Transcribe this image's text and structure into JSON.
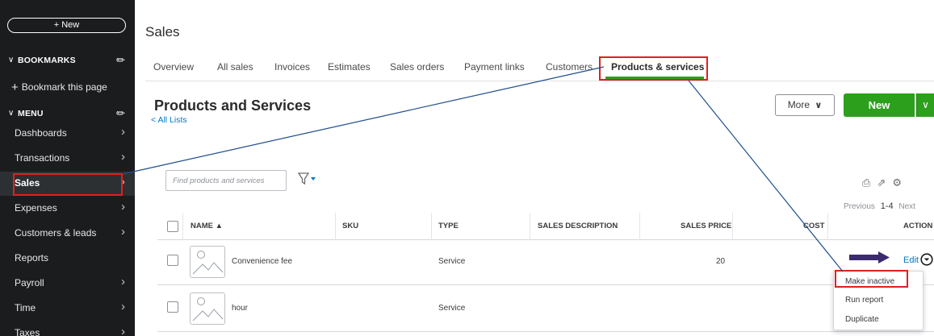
{
  "sidebar": {
    "new_label": "+ New",
    "bookmarks_label": "BOOKMARKS",
    "bookmark_page_label": "Bookmark this page",
    "menu_label": "MENU",
    "items": [
      {
        "label": "Dashboards",
        "has_arrow": true
      },
      {
        "label": "Transactions",
        "has_arrow": true
      },
      {
        "label": "Sales",
        "has_arrow": true,
        "active": true
      },
      {
        "label": "Expenses",
        "has_arrow": true
      },
      {
        "label": "Customers & leads",
        "has_arrow": true
      },
      {
        "label": "Reports",
        "has_arrow": false
      },
      {
        "label": "Payroll",
        "has_arrow": true
      },
      {
        "label": "Time",
        "has_arrow": true
      },
      {
        "label": "Taxes",
        "has_arrow": true
      }
    ]
  },
  "header": {
    "title": "Sales",
    "tabs": [
      {
        "label": "Overview"
      },
      {
        "label": "All sales"
      },
      {
        "label": "Invoices"
      },
      {
        "label": "Estimates"
      },
      {
        "label": "Sales orders"
      },
      {
        "label": "Payment links"
      },
      {
        "label": "Customers"
      },
      {
        "label": "Products & services",
        "active": true
      }
    ]
  },
  "main": {
    "title": "Products and Services",
    "back_link": "< All Lists",
    "more_label": "More",
    "new_label": "New",
    "search_placeholder": "Find products and services",
    "pager": {
      "previous": "Previous",
      "range": "1-4",
      "next": "Next"
    }
  },
  "table": {
    "columns": [
      "NAME ▲",
      "SKU",
      "TYPE",
      "SALES DESCRIPTION",
      "SALES PRICE",
      "COST",
      "ACTION"
    ],
    "rows": [
      {
        "name": "Convenience fee",
        "sku": "",
        "type": "Service",
        "sales_description": "",
        "sales_price": "20",
        "cost": "",
        "action": "Edit"
      },
      {
        "name": "hour",
        "sku": "",
        "type": "Service",
        "sales_description": "",
        "sales_price": "",
        "cost": "",
        "action": ""
      }
    ]
  },
  "action_menu": {
    "items": [
      "Make inactive",
      "Run report",
      "Duplicate"
    ]
  },
  "colors": {
    "brand_green": "#2ca01c",
    "link_blue": "#0077c5",
    "sidebar_bg": "#1a1c1e",
    "highlight_red": "#e02020",
    "annotation_line": "#1f4e8c",
    "annotation_arrow": "#3b2a6e"
  }
}
